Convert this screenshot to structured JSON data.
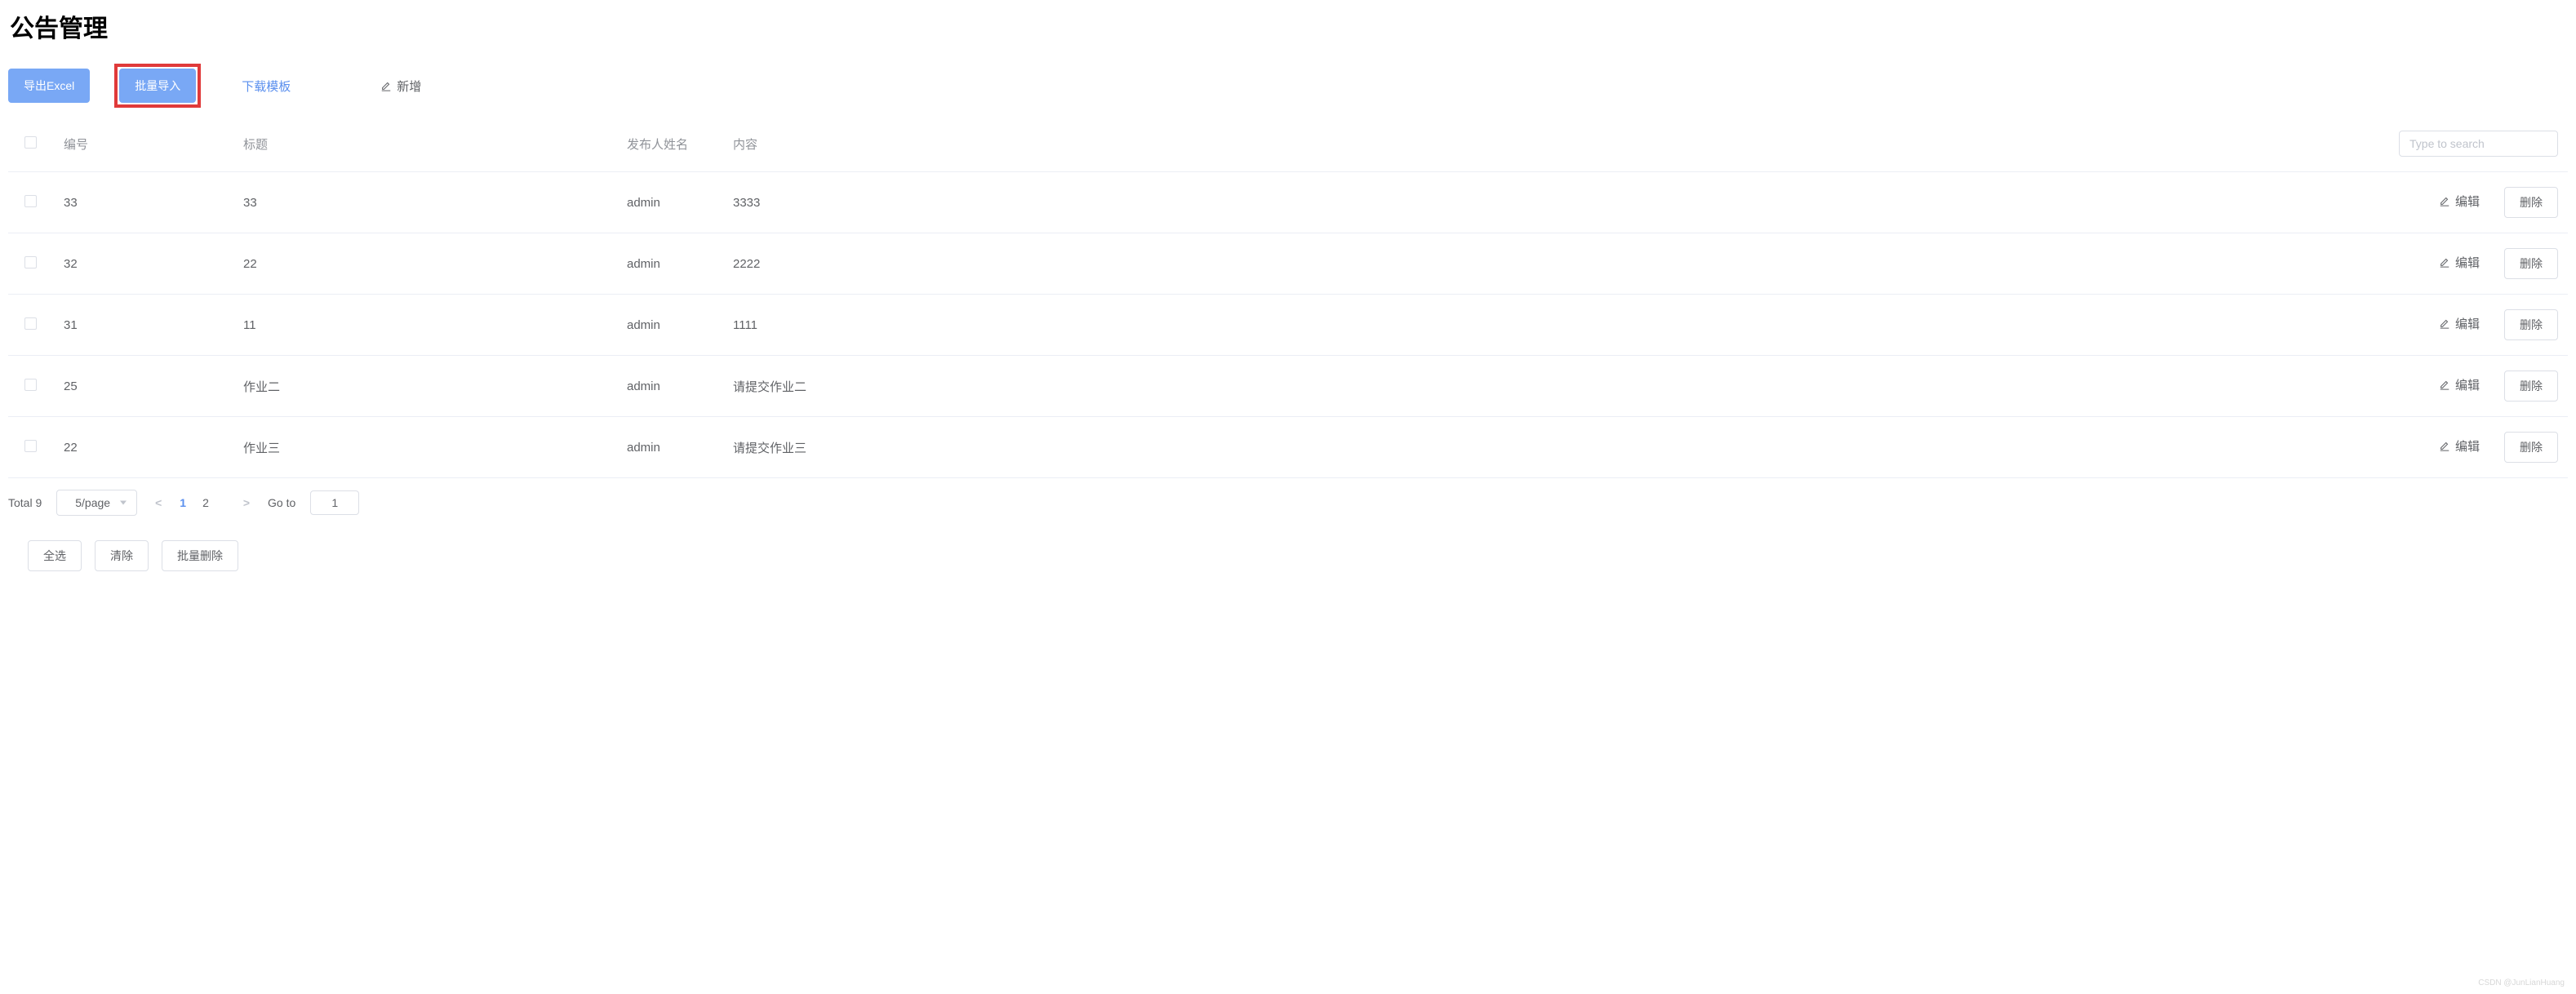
{
  "page": {
    "title": "公告管理"
  },
  "toolbar": {
    "export_label": "导出Excel",
    "import_label": "批量导入",
    "download_template_label": "下载模板",
    "add_label": "新增"
  },
  "table": {
    "headers": {
      "id": "编号",
      "title": "标题",
      "publisher": "发布人姓名",
      "content": "内容"
    },
    "search_placeholder": "Type to search",
    "edit_label": "编辑",
    "delete_label": "删除",
    "rows": [
      {
        "id": "33",
        "title": "33",
        "publisher": "admin",
        "content": "3333"
      },
      {
        "id": "32",
        "title": "22",
        "publisher": "admin",
        "content": "2222"
      },
      {
        "id": "31",
        "title": "11",
        "publisher": "admin",
        "content": "1111"
      },
      {
        "id": "25",
        "title": "作业二",
        "publisher": "admin",
        "content": "请提交作业二"
      },
      {
        "id": "22",
        "title": "作业三",
        "publisher": "admin",
        "content": "请提交作业三"
      }
    ]
  },
  "pagination": {
    "total_label": "Total 9",
    "page_size_label": "5/page",
    "pages": [
      "1",
      "2"
    ],
    "active_page": "1",
    "goto_label": "Go to",
    "goto_value": "1"
  },
  "footer": {
    "select_all_label": "全选",
    "clear_label": "清除",
    "bulk_delete_label": "批量删除"
  },
  "watermark": "CSDN @JunLianHuang"
}
